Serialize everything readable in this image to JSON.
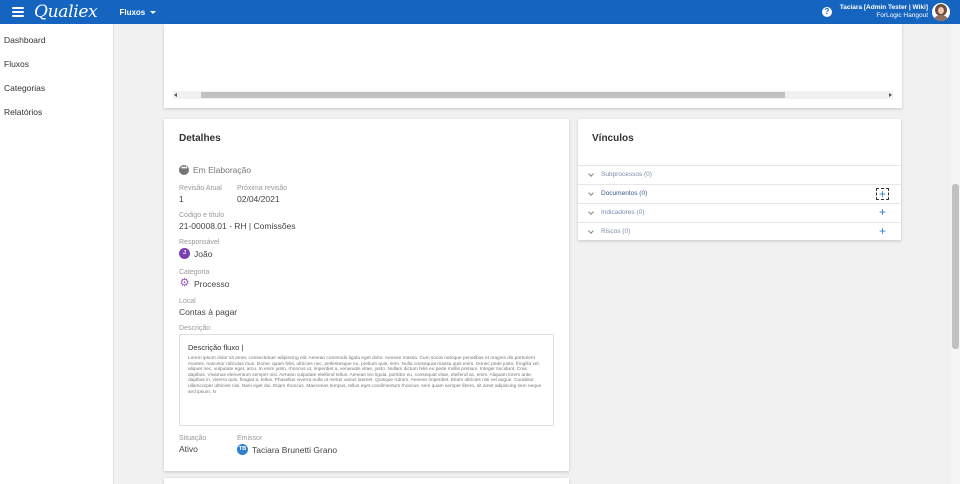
{
  "header": {
    "logo": "Qualiex",
    "module": "Fluxos",
    "help": "?",
    "user_name": "Taciara [Admin Tester | Wiki]",
    "user_org": "ForLogic Hangout"
  },
  "sidebar": {
    "items": [
      {
        "label": "Dashboard"
      },
      {
        "label": "Fluxos"
      },
      {
        "label": "Categorias"
      },
      {
        "label": "Relatórios"
      }
    ]
  },
  "details": {
    "title": "Detalhes",
    "status_icon": "•••",
    "status": "Em Elaboração",
    "revision_label": "Revisão Atual",
    "revision_value": "1",
    "next_revision_label": "Próxima revisão",
    "next_revision_value": "02/04/2021",
    "code_label": "Código e título",
    "code_value": "21-00008.01 - RH | Comissões",
    "responsible_label": "Responsável",
    "responsible_initial": "J",
    "responsible_value": "João",
    "category_label": "Categoria",
    "category_value": "Processo",
    "place_label": "Local",
    "place_value": "Contas à pagar",
    "description_label": "Descrição",
    "description_title": "Descrição fluxo |",
    "description_text": "Lorem ipsum dolor sit amet, consectetuer adipiscing elit. Aenean commodo ligula eget dolor. Aenean massa. Cum sociis natoque penatibus et magnis dis parturient montes, nascetur ridiculus mus. Donec quam felis, ultricies nec, pellentesque eu, pretium quis, sem. Nulla consequat massa quis enim. Donec pede justo, fringilla vel, aliquet nec, vulputate eget, arcu. In enim justo, rhoncus ut, imperdiet a, venenatis vitae, justo. Nullam dictum felis eu pede mollis pretium. Integer tincidunt. Cras dapibus. Vivamus elementum semper nisi. Aenean vulputate eleifend tellus. Aenean leo ligula, porttitor eu, consequat vitae, eleifend ac, enim. Aliquam lorem ante, dapibus in, viverra quis, feugiat a, tellus. Phasellus viverra nulla ut metus varius laoreet. Quisque rutrum. Aenean imperdiet. Etiam ultricies nisi vel augue. Curabitur ullamcorper ultricies nisi. Nam eget dui. Etiam rhoncus. Maecenas tempus, tellus eget condimentum rhoncus, sem quam semper libero, sit amet adipiscing sem neque sed ipsum. N",
    "situation_label": "Situação",
    "situation_value": "Ativo",
    "issuer_label": "Emissor",
    "issuer_initials": "TB",
    "issuer_value": "Taciara Brunetti Grano"
  },
  "links": {
    "title": "Vínculos",
    "rows": [
      {
        "label": "Subprocessos (0)"
      },
      {
        "label": "Documentos (0)"
      },
      {
        "label": "Indicadores (0)"
      },
      {
        "label": "Riscos (0)"
      }
    ],
    "add": "+"
  },
  "colors": {
    "primary": "#1565c0",
    "accent": "#2f80d1",
    "purple": "#7b3fb0"
  }
}
